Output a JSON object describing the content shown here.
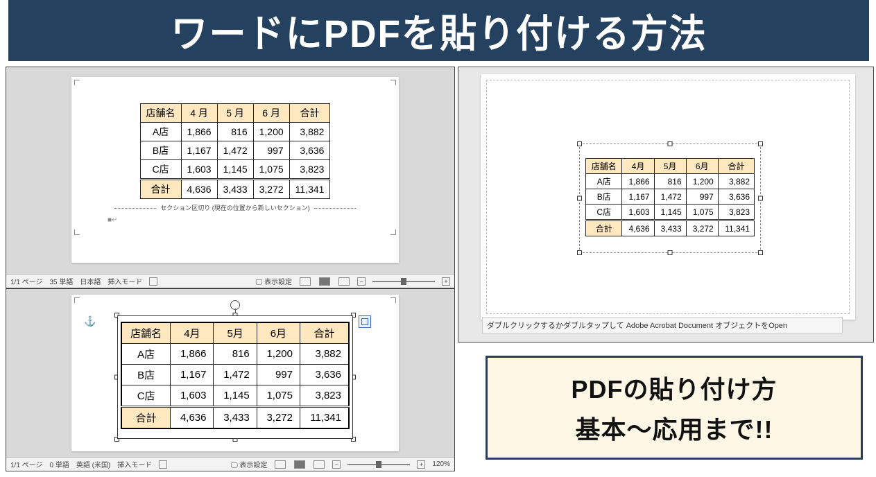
{
  "title": "ワードにPDFを貼り付ける方法",
  "callout": {
    "line1": "PDFの貼り付け方",
    "line2": "基本～応用まで!!"
  },
  "table": {
    "headers": [
      "店舗名",
      "4月",
      "5月",
      "6月",
      "合計"
    ],
    "rows": [
      {
        "label": "A店",
        "v": [
          "1,866",
          "816",
          "1,200",
          "3,882"
        ]
      },
      {
        "label": "B店",
        "v": [
          "1,167",
          "1,472",
          "997",
          "3,636"
        ]
      },
      {
        "label": "C店",
        "v": [
          "1,603",
          "1,145",
          "1,075",
          "3,823"
        ]
      }
    ],
    "total": {
      "label": "合計",
      "v": [
        "4,636",
        "3,433",
        "3,272",
        "11,341"
      ]
    }
  },
  "headers_spaced": [
    "店舗名",
    "4 月",
    "5 月",
    "6 月",
    "合計"
  ],
  "section_break_text": "セクション区切り (現在の位置から新しいセクション)",
  "status_ul": {
    "page": "1/1 ページ",
    "words": "35 単語",
    "lang": "日本語",
    "mode": "挿入モード",
    "display": "表示設定"
  },
  "status_ll": {
    "page": "1/1 ページ",
    "words": "0 単語",
    "lang": "英語 (米国)",
    "mode": "挿入モード",
    "display": "表示設定",
    "zoom": "120%"
  },
  "hint_r": "ダブルクリックするかダブルタップして Adobe Acrobat Document オブジェクトをOpen",
  "headers_compact": [
    "店舗名",
    "4月",
    "5月",
    "6月",
    "合計"
  ]
}
